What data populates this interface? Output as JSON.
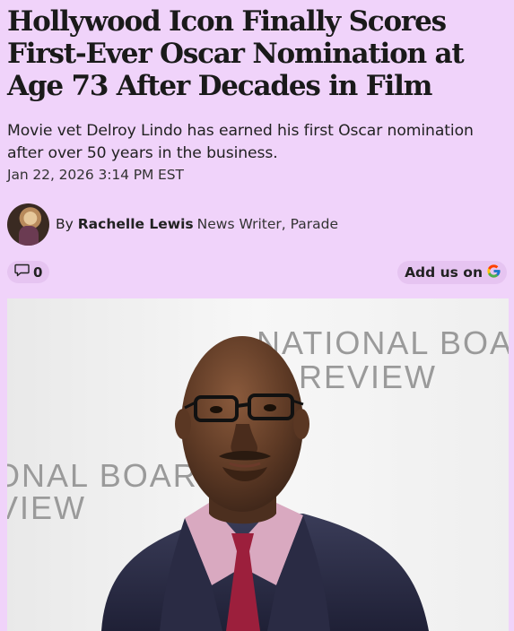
{
  "article": {
    "headline": "Hollywood Icon Finally Scores First-Ever Oscar Nomination at Age 73 After Decades in Film",
    "dek": "Movie vet Delroy Lindo has earned his first Oscar nomination after over 50 years in the business.",
    "date": "Jan 22, 2026 3:14 PM EST"
  },
  "byline": {
    "prefix": "By",
    "author": "Rachelle Lewis",
    "role": "News Writer, Parade"
  },
  "actions": {
    "comment_count": "0",
    "add_us_label": "Add us on",
    "add_us_icon": "google-g-icon"
  },
  "photo": {
    "backdrop_line1": "NATIONAL BOA",
    "backdrop_line2": "REVIEW",
    "backdrop_left1": "ONAL BOAR",
    "backdrop_left2": "VIEW"
  },
  "colors": {
    "page_background": "#f0d3fa",
    "pill_background": "#e6c4f1"
  }
}
